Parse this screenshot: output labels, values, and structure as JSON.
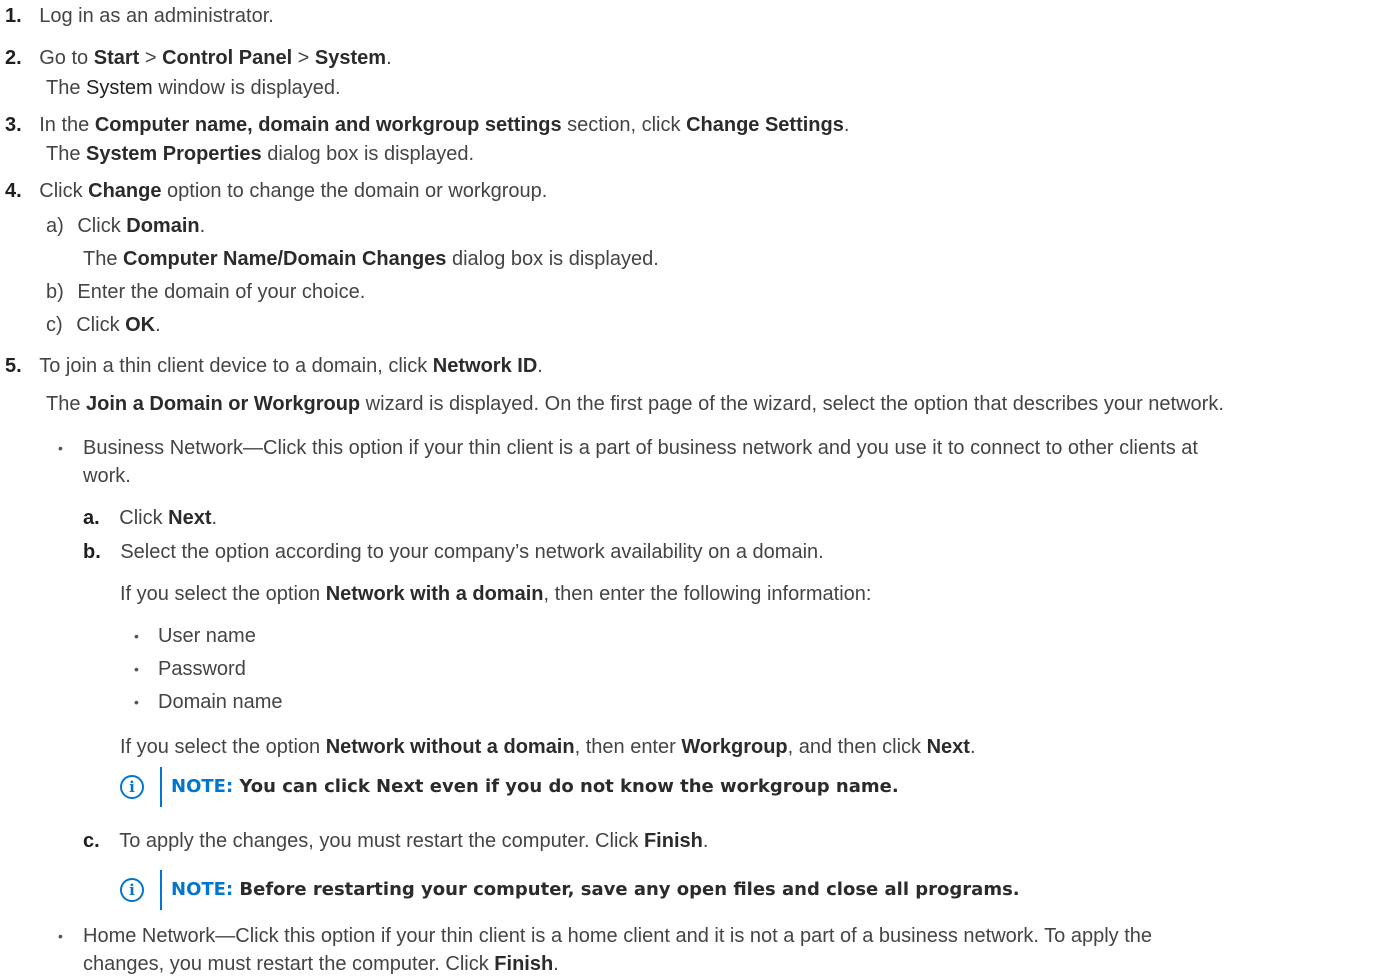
{
  "steps": [
    {
      "num": "1.",
      "text": "Log in as an administrator."
    },
    {
      "num": "2.",
      "pre": "Go to ",
      "b1": "Start",
      "mid1": " > ",
      "b2": "Control Panel",
      "mid2": " > ",
      "b3": "System",
      "post": ".",
      "result_pre": "The ",
      "result_bold": "System",
      "result_post": " window is displayed."
    },
    {
      "num": "3.",
      "pre": "In the ",
      "b1": "Computer name, domain and workgroup settings",
      "mid": " section, click ",
      "b2": "Change Settings",
      "post": ".",
      "result_pre": "The ",
      "result_bold": "System Properties",
      "result_post": " dialog box is displayed."
    },
    {
      "num": "4.",
      "pre": "Click ",
      "b1": "Change",
      "post": " option to change the domain or workgroup.",
      "substeps": [
        {
          "label": "a)",
          "pre": "Click ",
          "bold": "Domain",
          "post": ".",
          "result_pre": "The ",
          "result_bold": "Computer Name/Domain Changes",
          "result_post": " dialog box is displayed."
        },
        {
          "label": "b)",
          "text": "Enter the domain of your choice."
        },
        {
          "label": "c)",
          "pre": "Click ",
          "bold": "OK",
          "post": "."
        }
      ]
    },
    {
      "num": "5.",
      "pre": "To join a thin client device to a domain, click ",
      "b1": "Network ID",
      "post": ".",
      "result_pre": "The ",
      "result_bold": "Join a Domain or Workgroup",
      "result_post": " wizard is displayed. On the first page of the wizard, select the option that describes your network."
    }
  ],
  "business": {
    "bullet": "•",
    "line1": "Business Network—Click this option if your thin client is a part of business network and you use it to connect to other clients at",
    "line2": "work.",
    "a": {
      "label": "a.",
      "pre": "Click ",
      "bold": "Next",
      "post": "."
    },
    "b": {
      "label": "b.",
      "text": "Select the option according to your company’s network availability on a domain."
    },
    "domain_pre": "If you select the option ",
    "domain_bold": "Network with a domain",
    "domain_post": ", then enter the following information:",
    "fields": [
      "User name",
      "Password",
      "Domain name"
    ],
    "nodomain_pre": "If you select the option ",
    "nodomain_bold1": "Network without a domain",
    "nodomain_mid1": ", then enter ",
    "nodomain_bold2": "Workgroup",
    "nodomain_mid2": ", and then click ",
    "nodomain_bold3": "Next",
    "nodomain_post": ".",
    "note1_label": "NOTE:",
    "note1_text": " You can click Next even if you do not know the workgroup name.",
    "c": {
      "label": "c.",
      "pre": "To apply the changes, you must restart the computer. Click ",
      "bold": "Finish",
      "post": "."
    },
    "note2_label": "NOTE:",
    "note2_text": " Before restarting your computer, save any open files and close all programs."
  },
  "home": {
    "bullet": "•",
    "line1": "Home Network—Click this option if your thin client is a home client and it is not a part of a business network. To apply the",
    "line2_pre": "changes, you must restart the computer. Click ",
    "line2_bold": "Finish",
    "line2_post": "."
  },
  "icons": {
    "info": "i"
  },
  "colors": {
    "accent": "#0076ce"
  }
}
